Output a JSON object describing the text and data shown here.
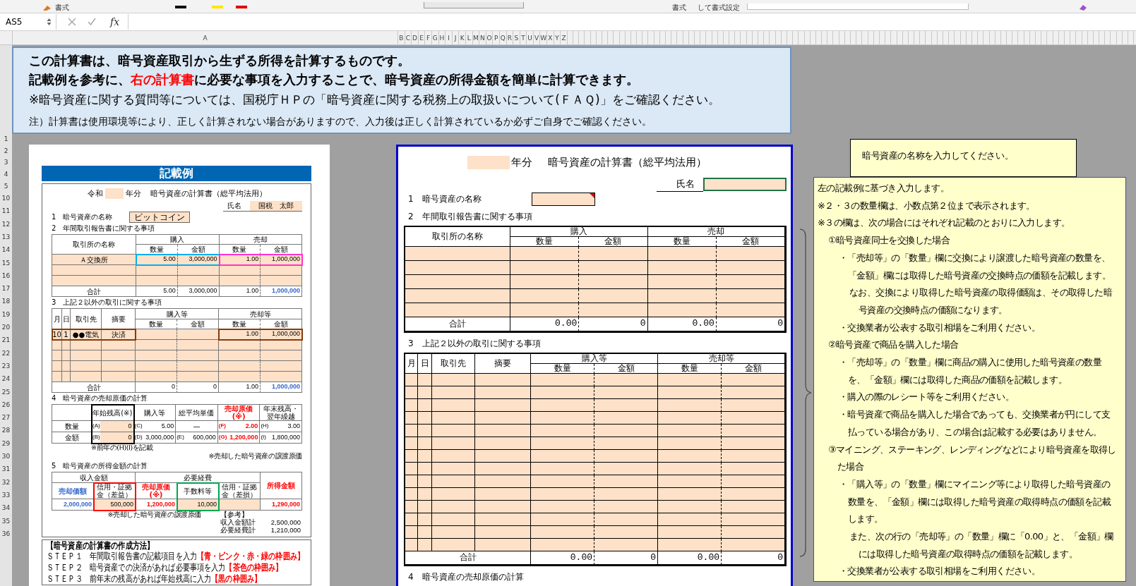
{
  "ribbon": {
    "labels": [
      "書式",
      "書式",
      "して書式設定"
    ]
  },
  "formula_bar": {
    "name_box": "AS5",
    "function_label": "fx"
  },
  "column_headers": [
    "A",
    "B",
    "C",
    "D",
    "E",
    "F",
    "G",
    "H",
    "I",
    "J",
    "K",
    "L",
    "M",
    "N",
    "O",
    "P",
    "Q",
    "R",
    "S",
    "T",
    "U",
    "V",
    "W",
    "X",
    "Y",
    "Z"
  ],
  "row_numbers": [
    "1",
    "2",
    "3",
    "4",
    "5",
    "10",
    "11",
    "12",
    "13",
    "14",
    "15",
    "16",
    "17",
    "18",
    "19",
    "20",
    "21",
    "22",
    "23",
    "24",
    "25",
    "26",
    "27",
    "28",
    "29",
    "30",
    "31",
    "32",
    "33",
    "34",
    "35",
    "36"
  ],
  "info_box": {
    "lines": [
      {
        "kind": "heading",
        "parts": [
          {
            "text": "この計算書は、暗号資産取引から生ずる所得を計算するものです。",
            "highlight": false
          }
        ]
      },
      {
        "kind": "heading",
        "parts": [
          {
            "text": "記載例を参考に、",
            "highlight": false
          },
          {
            "text": "右の計算書",
            "highlight": true
          },
          {
            "text": "に必要な事項を入力することで、暗号資産の所得金額を簡単に計算できます。",
            "highlight": false
          }
        ]
      },
      {
        "kind": "body",
        "parts": [
          {
            "text": "※暗号資産に関する質問等については、国税庁ＨＰの「暗号資産に関する税務上の取扱いについて(ＦＡＱ)」をご確認ください。",
            "highlight": false
          }
        ]
      },
      {
        "kind": "note",
        "parts": [
          {
            "text": "注）計算書は使用環境等により、正しく計算されない場合がありますので、入力後は正しく計算されているか必ずご自身でご確認ください。",
            "highlight": false
          }
        ]
      }
    ]
  },
  "example": {
    "banner": "記載例",
    "era": "令和",
    "year_suffix": "年分",
    "title": "暗号資産の計算書（総平均法用）",
    "name_label": "氏名",
    "name_value": "国税　太郎",
    "asset_label": "1　暗号資産の名称",
    "asset_value": "ビットコイン",
    "sections": [
      {
        "title": "2　年間取引報告書に関する事項",
        "table": {
          "rows": [
            [
              {
                "kind": "head",
                "text": "取引所の名称"
              },
              {
                "kind": "head",
                "text": "購入"
              },
              "",
              {
                "kind": "head",
                "text": "売却"
              },
              ""
            ],
            [
              "",
              {
                "kind": "head",
                "text": "数量"
              },
              {
                "kind": "head",
                "text": "金額"
              },
              {
                "kind": "head",
                "text": "数量"
              },
              {
                "kind": "head",
                "text": "金額"
              }
            ],
            [
              {
                "kind": "entry",
                "text": "Ａ交換所"
              },
              {
                "kind": "entry_num",
                "text": "5.00",
                "frame": {
                  "color": "#00b0f0"
                }
              },
              {
                "kind": "entry_num",
                "text": "3,000,000",
                "frame": {
                  "color": "#00b0f0"
                }
              },
              {
                "kind": "entry_num",
                "text": "1.00",
                "frame": {
                  "color": "#ff33cc"
                }
              },
              {
                "kind": "entry_num",
                "text": "1,000,000",
                "frame": {
                  "color": "#ff33cc"
                }
              }
            ],
            [
              {
                "kind": "entry"
              },
              {
                "kind": "entry"
              },
              {
                "kind": "entry"
              },
              {
                "kind": "entry"
              },
              {
                "kind": "entry"
              }
            ],
            [
              {
                "kind": "entry"
              },
              {
                "kind": "entry"
              },
              {
                "kind": "entry"
              },
              {
                "kind": "entry"
              },
              {
                "kind": "entry"
              }
            ],
            [
              {
                "kind": "text",
                "text": "合計"
              },
              {
                "kind": "num",
                "text": "5.00"
              },
              {
                "kind": "num",
                "text": "3,000,000"
              },
              {
                "kind": "num",
                "text": "1.00"
              },
              {
                "kind": "num",
                "text": "1,000,000",
                "color": "#3366cc"
              }
            ]
          ]
        }
      },
      {
        "title": "3　上記２以外の取引に関する事項",
        "table": {
          "rows": [
            [
              {
                "kind": "head",
                "text": "月"
              },
              {
                "kind": "head",
                "text": "日"
              },
              {
                "kind": "head",
                "text": "取引先"
              },
              {
                "kind": "head",
                "text": "摘要"
              },
              {
                "kind": "head",
                "text": "購入等"
              },
              "",
              {
                "kind": "head",
                "text": "売却等"
              },
              ""
            ],
            [
              "",
              "",
              "",
              "",
              {
                "kind": "head",
                "text": "数量"
              },
              {
                "kind": "head",
                "text": "金額"
              },
              {
                "kind": "head",
                "text": "数量"
              },
              {
                "kind": "head",
                "text": "金額"
              }
            ],
            [
              {
                "kind": "entry",
                "text": "10",
                "frame": {
                  "color": "#843c0c"
                }
              },
              {
                "kind": "entry",
                "text": "1",
                "frame": {
                  "color": "#843c0c"
                }
              },
              {
                "kind": "entry",
                "text": "●●電気",
                "frame": {
                  "color": "#843c0c"
                }
              },
              {
                "kind": "entry",
                "text": "決済",
                "frame": {
                  "color": "#843c0c"
                }
              },
              {
                "kind": "entry"
              },
              {
                "kind": "entry"
              },
              {
                "kind": "entry_num",
                "text": "1.00",
                "frame": {
                  "color": "#843c0c"
                }
              },
              {
                "kind": "entry_num",
                "text": "1,000,000",
                "frame": {
                  "color": "#843c0c"
                }
              }
            ],
            [
              {
                "kind": "entry"
              },
              {
                "kind": "entry"
              },
              {
                "kind": "entry"
              },
              {
                "kind": "entry"
              },
              {
                "kind": "entry"
              },
              {
                "kind": "entry"
              },
              {
                "kind": "entry"
              },
              {
                "kind": "entry"
              }
            ],
            [
              {
                "kind": "entry"
              },
              {
                "kind": "entry"
              },
              {
                "kind": "entry"
              },
              {
                "kind": "entry"
              },
              {
                "kind": "entry"
              },
              {
                "kind": "entry"
              },
              {
                "kind": "entry"
              },
              {
                "kind": "entry"
              }
            ],
            [
              {
                "kind": "entry"
              },
              {
                "kind": "entry"
              },
              {
                "kind": "entry"
              },
              {
                "kind": "entry"
              },
              {
                "kind": "entry"
              },
              {
                "kind": "entry"
              },
              {
                "kind": "entry"
              },
              {
                "kind": "entry"
              }
            ],
            [
              {
                "kind": "entry"
              },
              {
                "kind": "entry"
              },
              {
                "kind": "entry"
              },
              {
                "kind": "entry"
              },
              {
                "kind": "entry"
              },
              {
                "kind": "entry"
              },
              {
                "kind": "entry"
              },
              {
                "kind": "entry"
              }
            ],
            [
              "",
              "",
              {
                "kind": "text",
                "text": "合計"
              },
              "",
              {
                "kind": "num",
                "text": "0"
              },
              {
                "kind": "num",
                "text": "0"
              },
              {
                "kind": "num",
                "text": "1.00"
              },
              {
                "kind": "num",
                "text": "1,000,000",
                "color": "#3366cc"
              }
            ]
          ]
        }
      },
      {
        "title": "4　暗号資産の売却原価の計算",
        "table": {
          "rows": [
            [
              {
                "kind": "head"
              },
              {
                "kind": "head",
                "text": "年始残高(※)",
                "frame": {
                  "color": "#000000"
                }
              },
              {
                "kind": "head",
                "text": "購入等"
              },
              {
                "kind": "head",
                "text": "総平均単価"
              },
              {
                "kind": "head",
                "text": "売却原価(※)",
                "color": "#ff0000"
              },
              {
                "kind": "head",
                "text": "年末残高・翌年繰越"
              }
            ],
            [
              {
                "kind": "text",
                "text": "数量"
              },
              {
                "kind": "entry_num",
                "label": "(A)",
                "text": "0",
                "frame": {
                  "color": "#000000"
                }
              },
              {
                "kind": "num",
                "label": "(C)",
                "text": "5.00"
              },
              {
                "kind": "text",
                "text": "—"
              },
              {
                "kind": "num",
                "label": "(F)",
                "text": "2.00",
                "color": "#ff0000"
              },
              {
                "kind": "num",
                "label": "(H)",
                "text": "3.00"
              }
            ],
            [
              {
                "kind": "text",
                "text": "金額"
              },
              {
                "kind": "entry_num",
                "label": "(B)",
                "text": "0",
                "frame": {
                  "color": "#000000"
                }
              },
              {
                "kind": "num",
                "label": "(D)",
                "text": "3,000,000"
              },
              {
                "kind": "num",
                "label": "(E)",
                "text": "600,000"
              },
              {
                "kind": "num",
                "label": "(G)",
                "text": "1,200,000",
                "color": "#ff0000"
              },
              {
                "kind": "num",
                "label": "(I)",
                "text": "1,800,000"
              }
            ]
          ]
        },
        "notes": [
          {
            "text": "※前年の(H)(I)を記載"
          },
          {
            "text": "※売却した暗号資産の譲渡原価"
          }
        ]
      },
      {
        "title": "5　暗号資産の所得金額の計算",
        "table": {
          "rows": [
            [
              {
                "kind": "head",
                "text": "収入金額"
              },
              "",
              "",
              {
                "kind": "head",
                "text": "必要経費"
              },
              "",
              ""
            ],
            [
              {
                "kind": "head",
                "text": "売却価額",
                "color": "#3366cc"
              },
              {
                "kind": "head",
                "text": "信用・証拠金（差益）",
                "frame": {
                  "color": "#ff0000"
                }
              },
              {
                "kind": "head",
                "text": "売却原価(※)",
                "color": "#ff0000"
              },
              {
                "kind": "head",
                "text": "手数料等",
                "frame": {
                  "color": "#00a650"
                }
              },
              {
                "kind": "head",
                "text": "信用・証拠金（差損）"
              },
              {
                "kind": "head",
                "text": "所得金額",
                "color": "#ff0000"
              }
            ],
            [
              {
                "kind": "num",
                "text": "2,000,000",
                "color": "#3366cc"
              },
              {
                "kind": "entry_num",
                "text": "500,000",
                "frame": {
                  "color": "#ff0000"
                }
              },
              {
                "kind": "num",
                "text": "1,200,000",
                "color": "#ff0000"
              },
              {
                "kind": "entry_num",
                "text": "10,000",
                "frame": {
                  "color": "#00a650"
                }
              },
              {
                "kind": "entry"
              },
              {
                "kind": "num",
                "text": "1,290,000",
                "color": "#ff0000"
              }
            ]
          ]
        },
        "notes": [
          {
            "text": "※売却した暗号資産の譲渡原価"
          }
        ],
        "reference": {
          "title": "【参考】",
          "rows": [
            {
              "label": "収入金額計",
              "value": "2,500,000"
            },
            {
              "label": "必要経費計",
              "value": "1,210,000"
            }
          ]
        }
      }
    ],
    "method": {
      "title": "【暗号資産の計算書の作成方法】",
      "steps": [
        {
          "text": "ＳＴＥＰ１　年間取引報告書の記載項目を入力",
          "tag": "【青・ピンク・赤・緑の枠囲み】"
        },
        {
          "text": "ＳＴＥＰ２　暗号資産での決済があれば必要事項を入力",
          "tag": "【茶色の枠囲み】"
        },
        {
          "text": "ＳＴＥＰ３　前年末の残高があれば年始残高に入力",
          "tag": "【黒の枠囲み】"
        }
      ]
    }
  },
  "form": {
    "year_suffix": "年分",
    "title": "暗号資産の計算書（総平均法用）",
    "name_label": "氏名",
    "name_field": {
      "selected": true
    },
    "asset_label": "1　暗号資産の名称",
    "asset_field": {
      "comment": true
    },
    "sections": [
      {
        "title": "2　年間取引報告書に関する事項",
        "table": {
          "rows": [
            [
              {
                "kind": "head",
                "text": "取引所の名称"
              },
              {
                "kind": "head",
                "text": "購入"
              },
              "",
              {
                "kind": "head",
                "text": "売却"
              },
              ""
            ],
            [
              "",
              {
                "kind": "head",
                "text": "数量"
              },
              {
                "kind": "head",
                "text": "金額"
              },
              {
                "kind": "head",
                "text": "数量"
              },
              {
                "kind": "head",
                "text": "金額"
              }
            ],
            [
              {
                "kind": "entry"
              },
              {
                "kind": "entry"
              },
              {
                "kind": "entry"
              },
              {
                "kind": "entry"
              },
              {
                "kind": "entry"
              }
            ],
            [
              {
                "kind": "entry"
              },
              {
                "kind": "entry"
              },
              {
                "kind": "entry"
              },
              {
                "kind": "entry"
              },
              {
                "kind": "entry"
              }
            ],
            [
              {
                "kind": "entry"
              },
              {
                "kind": "entry"
              },
              {
                "kind": "entry"
              },
              {
                "kind": "entry"
              },
              {
                "kind": "entry"
              }
            ],
            [
              {
                "kind": "entry"
              },
              {
                "kind": "entry"
              },
              {
                "kind": "entry"
              },
              {
                "kind": "entry"
              },
              {
                "kind": "entry"
              }
            ],
            [
              {
                "kind": "entry"
              },
              {
                "kind": "entry"
              },
              {
                "kind": "entry"
              },
              {
                "kind": "entry"
              },
              {
                "kind": "entry"
              }
            ],
            [
              {
                "kind": "text",
                "text": "合計"
              },
              {
                "kind": "num",
                "text": "0.00"
              },
              {
                "kind": "num",
                "text": "0"
              },
              {
                "kind": "num",
                "text": "0.00"
              },
              {
                "kind": "num",
                "text": "0"
              }
            ]
          ]
        }
      },
      {
        "title": "3　上記２以外の取引に関する事項",
        "table": {
          "rows": [
            [
              {
                "kind": "head",
                "text": "月"
              },
              {
                "kind": "head",
                "text": "日"
              },
              {
                "kind": "head",
                "text": "取引先"
              },
              {
                "kind": "head",
                "text": "摘要"
              },
              {
                "kind": "head",
                "text": "購入等"
              },
              "",
              {
                "kind": "head",
                "text": "売却等"
              },
              ""
            ],
            [
              "",
              "",
              "",
              "",
              {
                "kind": "head",
                "text": "数量"
              },
              {
                "kind": "head",
                "text": "金額"
              },
              {
                "kind": "head",
                "text": "数量"
              },
              {
                "kind": "head",
                "text": "金額"
              }
            ],
            [
              {
                "kind": "entry"
              },
              {
                "kind": "entry"
              },
              {
                "kind": "entry"
              },
              {
                "kind": "entry"
              },
              {
                "kind": "entry"
              },
              {
                "kind": "entry"
              },
              {
                "kind": "entry"
              },
              {
                "kind": "entry"
              }
            ],
            [
              {
                "kind": "entry"
              },
              {
                "kind": "entry"
              },
              {
                "kind": "entry"
              },
              {
                "kind": "entry"
              },
              {
                "kind": "entry"
              },
              {
                "kind": "entry"
              },
              {
                "kind": "entry"
              },
              {
                "kind": "entry"
              }
            ],
            [
              {
                "kind": "entry"
              },
              {
                "kind": "entry"
              },
              {
                "kind": "entry"
              },
              {
                "kind": "entry"
              },
              {
                "kind": "entry"
              },
              {
                "kind": "entry"
              },
              {
                "kind": "entry"
              },
              {
                "kind": "entry"
              }
            ],
            [
              {
                "kind": "entry"
              },
              {
                "kind": "entry"
              },
              {
                "kind": "entry"
              },
              {
                "kind": "entry"
              },
              {
                "kind": "entry"
              },
              {
                "kind": "entry"
              },
              {
                "kind": "entry"
              },
              {
                "kind": "entry"
              }
            ],
            [
              {
                "kind": "entry"
              },
              {
                "kind": "entry"
              },
              {
                "kind": "entry"
              },
              {
                "kind": "entry"
              },
              {
                "kind": "entry"
              },
              {
                "kind": "entry"
              },
              {
                "kind": "entry"
              },
              {
                "kind": "entry"
              }
            ],
            [
              {
                "kind": "entry"
              },
              {
                "kind": "entry"
              },
              {
                "kind": "entry"
              },
              {
                "kind": "entry"
              },
              {
                "kind": "entry"
              },
              {
                "kind": "entry"
              },
              {
                "kind": "entry"
              },
              {
                "kind": "entry"
              }
            ],
            [
              {
                "kind": "entry"
              },
              {
                "kind": "entry"
              },
              {
                "kind": "entry"
              },
              {
                "kind": "entry"
              },
              {
                "kind": "entry"
              },
              {
                "kind": "entry"
              },
              {
                "kind": "entry"
              },
              {
                "kind": "entry"
              }
            ],
            [
              {
                "kind": "entry"
              },
              {
                "kind": "entry"
              },
              {
                "kind": "entry"
              },
              {
                "kind": "entry"
              },
              {
                "kind": "entry"
              },
              {
                "kind": "entry"
              },
              {
                "kind": "entry"
              },
              {
                "kind": "entry"
              }
            ],
            [
              {
                "kind": "entry"
              },
              {
                "kind": "entry"
              },
              {
                "kind": "entry"
              },
              {
                "kind": "entry"
              },
              {
                "kind": "entry"
              },
              {
                "kind": "entry"
              },
              {
                "kind": "entry"
              },
              {
                "kind": "entry"
              }
            ],
            [
              {
                "kind": "entry"
              },
              {
                "kind": "entry"
              },
              {
                "kind": "entry"
              },
              {
                "kind": "entry"
              },
              {
                "kind": "entry"
              },
              {
                "kind": "entry"
              },
              {
                "kind": "entry"
              },
              {
                "kind": "entry"
              }
            ],
            [
              {
                "kind": "entry"
              },
              {
                "kind": "entry"
              },
              {
                "kind": "entry"
              },
              {
                "kind": "entry"
              },
              {
                "kind": "entry"
              },
              {
                "kind": "entry"
              },
              {
                "kind": "entry"
              },
              {
                "kind": "entry"
              }
            ],
            [
              {
                "kind": "entry"
              },
              {
                "kind": "entry"
              },
              {
                "kind": "entry"
              },
              {
                "kind": "entry"
              },
              {
                "kind": "entry"
              },
              {
                "kind": "entry"
              },
              {
                "kind": "entry"
              },
              {
                "kind": "entry"
              }
            ],
            [
              {
                "kind": "entry"
              },
              {
                "kind": "entry"
              },
              {
                "kind": "entry"
              },
              {
                "kind": "entry"
              },
              {
                "kind": "entry"
              },
              {
                "kind": "entry"
              },
              {
                "kind": "entry"
              },
              {
                "kind": "entry"
              }
            ],
            [
              {
                "kind": "entry"
              },
              {
                "kind": "entry"
              },
              {
                "kind": "entry"
              },
              {
                "kind": "entry"
              },
              {
                "kind": "entry"
              },
              {
                "kind": "entry"
              },
              {
                "kind": "entry"
              },
              {
                "kind": "entry"
              }
            ],
            [
              "",
              "",
              {
                "kind": "text",
                "text": "合計"
              },
              "",
              {
                "kind": "num",
                "text": "0.00"
              },
              {
                "kind": "num",
                "text": "0"
              },
              {
                "kind": "num",
                "text": "0.00"
              },
              {
                "kind": "num",
                "text": "0"
              }
            ]
          ]
        }
      },
      {
        "title": "4　暗号資産の売却原価の計算"
      }
    ]
  },
  "comment": {
    "text": "暗号資産の名称を入力してください。"
  },
  "notes": {
    "items": [
      {
        "text": "左の記載例に基づき入力します。"
      },
      {
        "text": "※２・３の数量欄は、小数点第２位まで表示されます。"
      },
      {
        "text": "※３の欄は、次の場合にはそれぞれ記載のとおりに入力します。",
        "children": [
          {
            "text": "①暗号資産同士を交換した場合",
            "children": [
              {
                "text": "・「売却等」の「数量」欄に交換により譲渡した暗号資産の数量を、「金額」欄には取得した暗号資産の交換時点の価額を記載します。",
                "children": [
                  {
                    "text": "なお、交換により取得した暗号資産の取得価額は、その取得した暗号資産の交換時点の価額になります。"
                  }
                ]
              },
              {
                "text": "・交換業者が公表する取引相場をご利用ください。"
              }
            ]
          },
          {
            "text": "②暗号資産で商品を購入した場合",
            "children": [
              {
                "text": "・「売却等」の「数量」欄に商品の購入に使用した暗号資産の数量を、「金額」欄には取得した商品の価額を記載します。"
              },
              {
                "text": "・購入の際のレシート等をご利用ください。"
              },
              {
                "text": "・暗号資産で商品を購入した場合であっても、交換業者が円にして支払っている場合があり、この場合は記載する必要はありません。"
              }
            ]
          },
          {
            "text": "③マイニング、ステーキング、レンディングなどにより暗号資産を取得した場合",
            "children": [
              {
                "text": "・「購入等」の「数量」欄にマイニング等により取得した暗号資産の数量を、「金額」欄には取得した暗号資産の取得時点の価額を記載します。",
                "children": [
                  {
                    "text": "また、次の行の「売却等」の「数量」欄に「0.00」と、「金額」欄には取得した暗号資産の取得時点の価額を記載します。"
                  }
                ]
              },
              {
                "text": "・交換業者が公表する取引相場をご利用ください。"
              }
            ]
          }
        ]
      }
    ]
  }
}
